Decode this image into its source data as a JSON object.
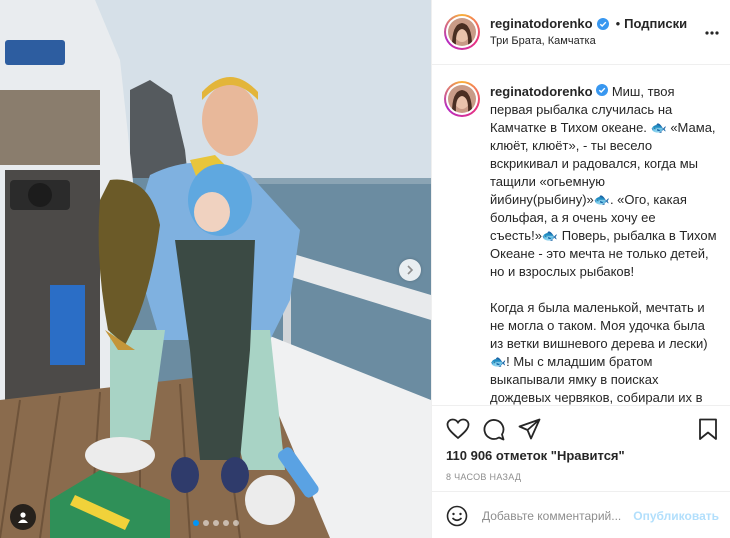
{
  "post": {
    "username": "reginatodorenko",
    "separator": "•",
    "follow_label": "Подписки",
    "location": "Три Брата, Камчатка",
    "caption_text": "Миш, твоя первая рыбалка случилась на Камчатке в Тихом океане. 🐟 «Мама, клюёт, клюёт», - ты весело вскрикивал и радовался, когда мы тащили «огьемную йибину(рыбину)»🐟. «Ого, какая больфая, а я очень хочу ее съесть!»🐟 Поверь, рыбалка в Тихом Океане - это мечта не только детей, но и взрослых рыбаков!\n\nКогда я была маленькой, мечтать и не могла о таком. Моя удочка была из ветки вишневого дерева и лески)🐟! Мы с младшим братом выкапывали ямку в поисках дождевых червяков, собирали их в баночку и шли рыбачить) Вылавливали костлявого бычка в",
    "likes_text": "110 906 отметок \"Нравится\"",
    "time_ago": "8 часов назад"
  },
  "comment": {
    "placeholder": "Добавьте комментарий...",
    "publish_label": "Опубликовать"
  },
  "carousel": {
    "count": 5,
    "active_index": 0
  },
  "icons": [
    "more-icon",
    "verified-icon",
    "heart-icon",
    "comment-icon",
    "share-icon",
    "bookmark-icon",
    "emoji-icon",
    "user-tag-icon",
    "chevron-right-icon"
  ],
  "colors": {
    "verified": "#3897f0",
    "publish": "#b2dffc",
    "active_dot": "#0095f6",
    "text": "#262626",
    "muted": "#8e8e8e"
  }
}
